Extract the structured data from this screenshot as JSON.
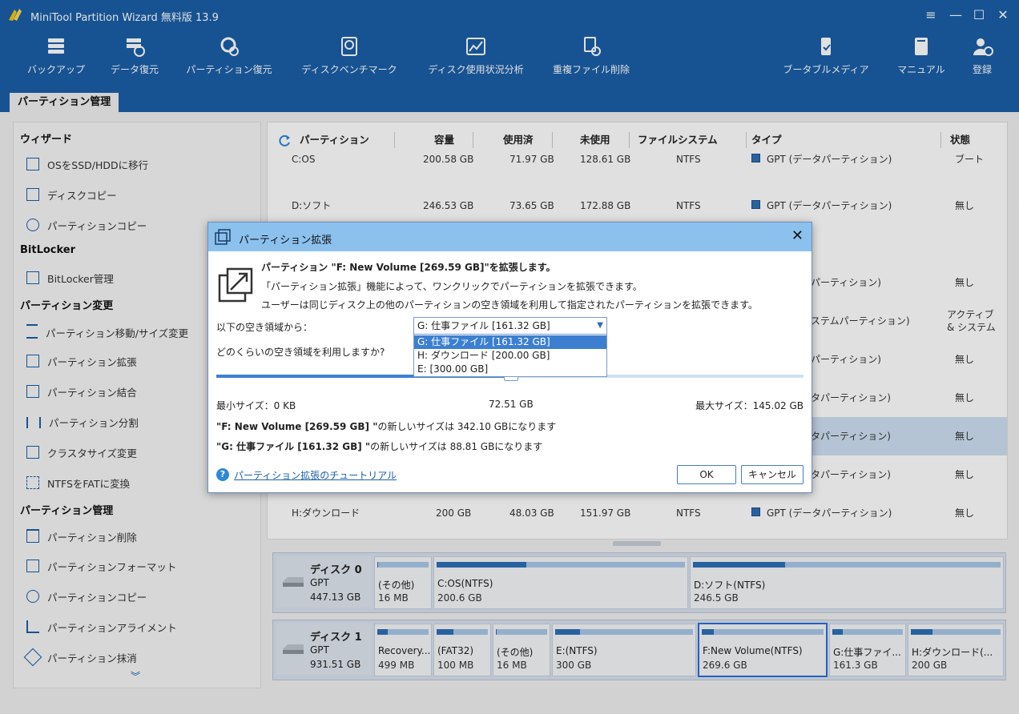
{
  "app": {
    "title": "MiniTool Partition Wizard 無料版 13.9"
  },
  "toolbar": {
    "items": [
      {
        "label": "バックアップ",
        "icon": "backup-icon"
      },
      {
        "label": "データ復元",
        "icon": "data-recovery-icon"
      },
      {
        "label": "パーティション復元",
        "icon": "partition-recovery-icon"
      },
      {
        "label": "ディスクベンチマーク",
        "icon": "disk-benchmark-icon"
      },
      {
        "label": "ディスク使用状況分析",
        "icon": "space-analyzer-icon"
      },
      {
        "label": "重複ファイル削除",
        "icon": "duplicate-file-icon"
      }
    ],
    "right_items": [
      {
        "label": "ブータブルメディア",
        "icon": "bootable-media-icon"
      },
      {
        "label": "マニュアル",
        "icon": "manual-icon"
      },
      {
        "label": "登録",
        "icon": "register-icon"
      }
    ]
  },
  "tab": {
    "label": "パーティション管理"
  },
  "sidebar": {
    "sections": [
      {
        "title": "ウィザード",
        "items": [
          "OSをSSD/HDDに移行",
          "ディスクコピー",
          "パーティションコピー"
        ]
      },
      {
        "title": "BitLocker",
        "items": [
          "BitLocker管理"
        ]
      },
      {
        "title": "パーティション変更",
        "items": [
          "パーティション移動/サイズ変更",
          "パーティション拡張",
          "パーティション結合",
          "パーティション分割",
          "クラスタサイズ変更",
          "NTFSをFATに変換"
        ]
      },
      {
        "title": "パーティション管理",
        "items": [
          "パーティション削除",
          "パーティションフォーマット",
          "パーティションコピー",
          "パーティションアライメント",
          "パーティション抹消"
        ]
      }
    ],
    "more": "︾"
  },
  "table": {
    "headers": [
      "パーティション",
      "容量",
      "使用済",
      "未使用",
      "ファイルシステム",
      "タイプ",
      "状態"
    ],
    "rows": [
      {
        "name": "C:OS",
        "cap": "200.58 GB",
        "used": "71.97 GB",
        "free": "128.61 GB",
        "fs": "NTFS",
        "type": "GPT (データパーティション)",
        "status": "ブート"
      },
      {
        "name": "D:ソフト",
        "cap": "246.53 GB",
        "used": "73.65 GB",
        "free": "172.88 GB",
        "fs": "NTFS",
        "type": "GPT (データパーティション)",
        "status": "無し"
      },
      {
        "name": "",
        "cap": "",
        "used": "",
        "free": "",
        "fs": "",
        "type": "",
        "status": ""
      },
      {
        "name": "",
        "cap": "",
        "used": "",
        "free": "",
        "fs": "",
        "type": "パーティション)",
        "status": "無し"
      },
      {
        "name": "",
        "cap": "",
        "used": "",
        "free": "",
        "fs": "",
        "type": "ステムパーティション)",
        "status": "アクティブ & システム"
      },
      {
        "name": "",
        "cap": "",
        "used": "",
        "free": "",
        "fs": "",
        "type": "パーティション)",
        "status": "無し"
      },
      {
        "name": "",
        "cap": "",
        "used": "",
        "free": "",
        "fs": "",
        "type": "タパーティション)",
        "status": "無し"
      },
      {
        "name": "",
        "cap": "",
        "used": "",
        "free": "",
        "fs": "",
        "type": "タパーティション)",
        "status": "無し"
      },
      {
        "name": "",
        "cap": "",
        "used": "",
        "free": "",
        "fs": "",
        "type": "タパーティション)",
        "status": "無し"
      },
      {
        "name": "H:ダウンロード",
        "cap": "200 GB",
        "used": "48.03 GB",
        "free": "151.97 GB",
        "fs": "NTFS",
        "type": "GPT (データパーティション)",
        "status": "無し"
      }
    ]
  },
  "disks": [
    {
      "name": "ディスク 0",
      "type": "GPT",
      "size": "447.13 GB",
      "partitions": [
        {
          "label": "(その他)",
          "size": "16 MB",
          "used": 0.02
        },
        {
          "label": "C:OS(NTFS)",
          "size": "200.6 GB",
          "used": 0.36
        },
        {
          "label": "D:ソフト(NTFS)",
          "size": "246.5 GB",
          "used": 0.3
        }
      ]
    },
    {
      "name": "ディスク 1",
      "type": "GPT",
      "size": "931.51 GB",
      "partitions": [
        {
          "label": "Recovery...",
          "size": "499 MB",
          "used": 0.2
        },
        {
          "label": "(FAT32)",
          "size": "100 MB",
          "used": 0.33
        },
        {
          "label": "(その他)",
          "size": "16 MB",
          "used": 0.02
        },
        {
          "label": "E:(NTFS)",
          "size": "300 GB",
          "used": 0.18
        },
        {
          "label": "F:New Volume(NTFS)",
          "size": "269.6 GB",
          "used": 0.1
        },
        {
          "label": "G:仕事ファイ...",
          "size": "161.3 GB",
          "used": 0.15
        },
        {
          "label": "H:ダウンロード(...",
          "size": "200 GB",
          "used": 0.24
        }
      ]
    }
  ],
  "dialog": {
    "title": "パーティション拡張",
    "heading": "パーティション \"F: New Volume [269.59 GB]\"を拡張します。",
    "desc1": "「パーティション拡張」機能によって、ワンクリックでパーティションを拡張できます。",
    "desc2": "ユーザーは同じディスク上の他のパーティションの空き領域を利用して指定されたパーティションを拡張できます。",
    "from_label": "以下の空き領域から：",
    "select_value": "G: 仕事ファイル [161.32 GB]",
    "options": [
      "G: 仕事ファイル [161.32 GB]",
      "H: ダウンロード [200.00 GB]",
      "E:  [300.00 GB]"
    ],
    "how_much_label": "どのくらいの空き領域を利用しますか?",
    "slider_fraction": 0.5,
    "min_label": "最小サイズ：0 KB",
    "mid_label": "72.51 GB",
    "max_label": "最大サイズ：145.02 GB",
    "new_size_f_name": "\"F: New Volume [269.59 GB] \"",
    "new_size_f_rest": "の新しいサイズは 342.10 GBになります",
    "new_size_g_name": "\"G: 仕事ファイル [161.32 GB] \"",
    "new_size_g_rest": "の新しいサイズは 88.81 GBになります",
    "tutorial_link": "パーティション拡張のチュートリアル",
    "ok": "OK",
    "cancel": "キャンセル"
  }
}
